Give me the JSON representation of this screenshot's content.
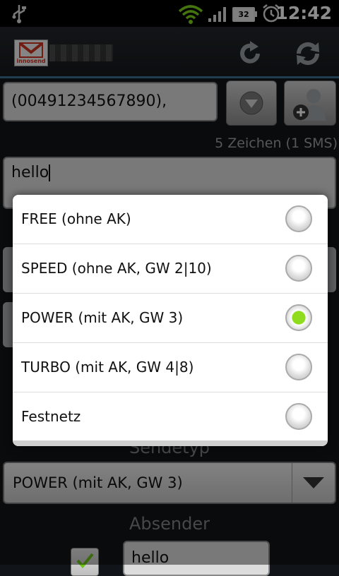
{
  "status_bar": {
    "time": "12:42",
    "battery_level": "32"
  },
  "form": {
    "recipient_value": "(00491234567890),",
    "char_count": "5 Zeichen (1 SMS)",
    "message_value": "hello",
    "sendetyp_label": "Sendetyp",
    "sendetyp_selected": "POWER (mit AK, GW 3)",
    "absender_label": "Absender",
    "sender_value": "hello"
  },
  "dialog": {
    "options": [
      {
        "label": "FREE (ohne AK)",
        "checked": false
      },
      {
        "label": "SPEED (ohne AK, GW 2|10)",
        "checked": false
      },
      {
        "label": "POWER (mit AK, GW 3)",
        "checked": true
      },
      {
        "label": "TURBO (mit AK, GW 4|8)",
        "checked": false
      },
      {
        "label": "Festnetz",
        "checked": false
      }
    ]
  },
  "colors": {
    "accent": "#3b6e93",
    "radio_checked": "#8fdc1e"
  },
  "icons": {
    "usb": "usb-icon",
    "wifi": "wifi-icon",
    "signal": "signal-icon",
    "battery": "battery-icon",
    "alarm": "alarm-icon",
    "app_logo": "app-logo",
    "refresh_1": "refresh-icon",
    "refresh_2": "sync-icon",
    "dropdown": "chevron-down-icon",
    "contacts": "add-contact-icon"
  }
}
